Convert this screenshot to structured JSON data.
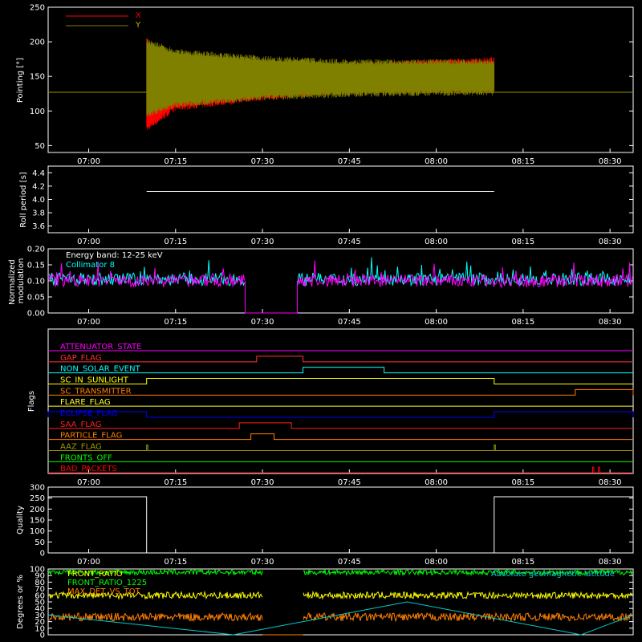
{
  "time_ticks": [
    "07:00",
    "07:15",
    "07:30",
    "07:45",
    "08:00",
    "08:15",
    "08:30"
  ],
  "colors": {
    "background": "#000000",
    "axes": "#ffffff",
    "x_series": "#ff0000",
    "y_series": "#7f7f00",
    "modulation": "#ff00ff",
    "collimator": "#00ffff",
    "front_ratio": "#00ff00",
    "front_ratio_1225": "#ffff00",
    "max_det_vs_tot": "#ff8000",
    "geomagnetic": "#00cccc"
  },
  "chart_data": [
    {
      "type": "line",
      "ylabel": "Pointing [°]",
      "ylim": [
        40,
        250
      ],
      "yticks": [
        "50",
        "100",
        "150",
        "200",
        "250"
      ],
      "xlim": [
        "06:53",
        "08:34"
      ],
      "legend_position": "top-left",
      "series": [
        {
          "name": "X",
          "note": "oscillation envelope",
          "x": [
            "07:10",
            "07:15",
            "07:30",
            "07:45",
            "08:00",
            "08:10"
          ],
          "upper": [
            205,
            170,
            165,
            170,
            175,
            178
          ],
          "lower": [
            70,
            100,
            115,
            125,
            125,
            125
          ]
        },
        {
          "name": "Y",
          "note": "oscillation envelope",
          "x": [
            "07:10",
            "07:15",
            "07:30",
            "07:45",
            "08:00",
            "08:10"
          ],
          "upper": [
            205,
            190,
            180,
            175,
            175,
            175
          ],
          "lower": [
            90,
            105,
            115,
            120,
            122,
            122
          ]
        }
      ],
      "baseline": 127
    },
    {
      "type": "line",
      "ylabel": "Roll period [s]",
      "ylim": [
        3.5,
        4.5
      ],
      "yticks": [
        "3.6",
        "3.8",
        "4.0",
        "4.2",
        "4.4"
      ],
      "series": [
        {
          "x": [
            "07:10",
            "08:10"
          ],
          "values": [
            4.12,
            4.12
          ]
        }
      ]
    },
    {
      "type": "line",
      "ylabel": "Normalized modulation",
      "ylim": [
        0,
        0.2
      ],
      "yticks": [
        "0.00",
        "0.05",
        "0.10",
        "0.15",
        "0.20"
      ],
      "annotation": "Energy band: 12-25 keV",
      "series": [
        {
          "name": "Collimator 8",
          "mean": 0.105,
          "spread": 0.02
        },
        {
          "name": "modulation",
          "mean": 0.1,
          "spread": 0.02
        }
      ],
      "gap": [
        "07:27",
        "07:36"
      ]
    },
    {
      "type": "line",
      "ylabel": "Flags",
      "flags": [
        {
          "name": "ATTENUATOR_STATE",
          "color": "#ff00ff",
          "high": []
        },
        {
          "name": "GAP_FLAG",
          "color": "#ff3333",
          "high": [
            [
              "07:29",
              "07:37"
            ]
          ]
        },
        {
          "name": "NON_SOLAR_EVENT",
          "color": "#00ffff",
          "high": [
            [
              "07:37",
              "07:51"
            ]
          ]
        },
        {
          "name": "SC_IN_SUNLIGHT",
          "color": "#ffff00",
          "high": [
            [
              "07:10",
              "08:10"
            ]
          ]
        },
        {
          "name": "SC_TRANSMITTER",
          "color": "#ff8000",
          "high": [
            [
              "08:24",
              "08:34"
            ]
          ]
        },
        {
          "name": "FLARE_FLAG",
          "color": "#ffff33",
          "high": []
        },
        {
          "name": "ECLIPSE_FLAG",
          "color": "#0000ff",
          "high": [
            [
              "06:53",
              "07:10"
            ],
            [
              "08:10",
              "08:34"
            ]
          ]
        },
        {
          "name": "SAA_FLAG",
          "color": "#ff2020",
          "high": [
            [
              "07:26",
              "07:35"
            ]
          ]
        },
        {
          "name": "PARTICLE_FLAG",
          "color": "#ff7f00",
          "high": [
            [
              "07:28",
              "07:32"
            ]
          ]
        },
        {
          "name": "AAZ_FLAG",
          "color": "#999900",
          "high": [
            [
              "07:10",
              "07:10"
            ],
            [
              "08:10",
              "08:10"
            ]
          ]
        },
        {
          "name": "FRONTS_OFF",
          "color": "#00ff00",
          "high": []
        },
        {
          "name": "BAD_PACKETS",
          "color": "#ff0000",
          "high": [
            [
              "08:27",
              "08:27"
            ],
            [
              "08:28",
              "08:28"
            ]
          ]
        }
      ]
    },
    {
      "type": "line",
      "ylabel": "Quality",
      "ylim": [
        0,
        300
      ],
      "yticks": [
        "0",
        "50",
        "100",
        "150",
        "200",
        "250",
        "300"
      ],
      "series": [
        {
          "x": [
            "06:53",
            "07:10",
            "07:10",
            "08:10",
            "08:10",
            "08:34"
          ],
          "values": [
            256,
            256,
            0,
            0,
            256,
            256
          ]
        }
      ]
    },
    {
      "type": "line",
      "ylabel": "Degrees or %",
      "ylim": [
        0,
        100
      ],
      "yticks": [
        "0",
        "10",
        "20",
        "30",
        "40",
        "50",
        "60",
        "70",
        "80",
        "90",
        "100"
      ],
      "legend_position": "top-left",
      "series": [
        {
          "name": "FRONT_RATIO",
          "mean": 95
        },
        {
          "name": "FRONT_RATIO_1225",
          "mean": 60
        },
        {
          "name": "MAX_DET_VS_TOT",
          "mean": 27
        },
        {
          "name": "Absolute geomagnetic latitude",
          "x": [
            "06:53",
            "07:25",
            "07:55",
            "08:25",
            "08:34"
          ],
          "values": [
            30,
            0,
            50,
            0,
            30
          ]
        }
      ],
      "gap": [
        "07:30",
        "07:37"
      ]
    }
  ]
}
